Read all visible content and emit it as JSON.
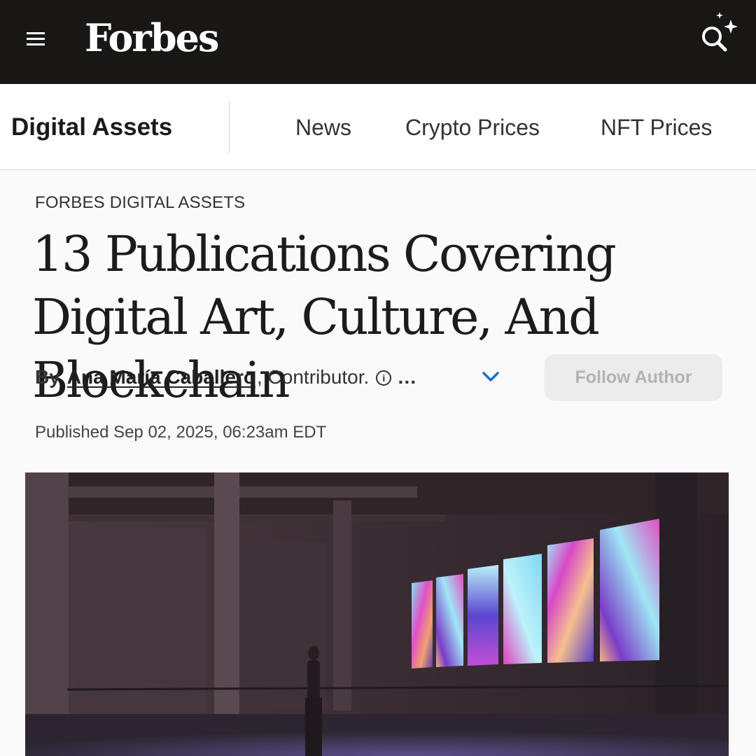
{
  "header": {
    "logo": "Forbes",
    "menu_icon": "hamburger-menu-icon",
    "search_icon": "ai-search-icon"
  },
  "subnav": {
    "section_title": "Digital Assets",
    "links": [
      "News",
      "Crypto Prices",
      "NFT Prices"
    ]
  },
  "article": {
    "kicker": "FORBES DIGITAL ASSETS",
    "headline": "13 Publications Covering Digital Art, Culture, And Blockchain",
    "byline": {
      "by": "By",
      "author": "Ana María Caballero",
      "role": ", Contributor.",
      "info_glyph": "i",
      "more": "…"
    },
    "follow_label": "Follow Author",
    "published": "Published Sep 02, 2025, 06:23am EDT"
  },
  "colors": {
    "topbar": "#181716",
    "accent_blue": "#1f6fc6",
    "follow_bg": "#ececec",
    "follow_text": "#b3b3b3"
  }
}
